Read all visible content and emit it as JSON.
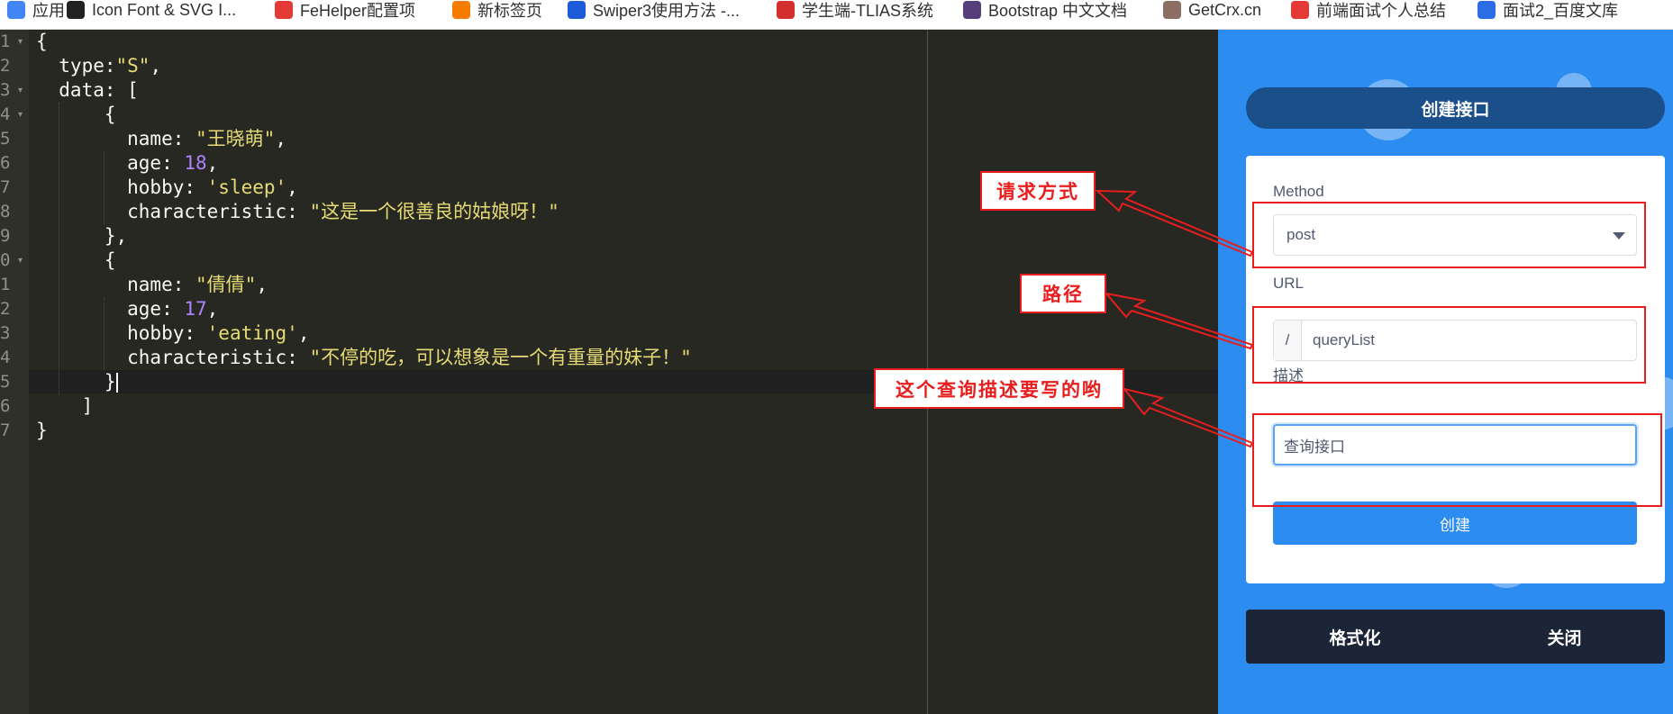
{
  "bookmarks": [
    {
      "label": "应用",
      "icon": "apps-grid-icon",
      "color": "#4285f4"
    },
    {
      "label": "Icon Font & SVG I...",
      "icon": "iconfont-icon",
      "color": "#222222"
    },
    {
      "label": "FeHelper配置项",
      "icon": "fehelper-icon",
      "color": "#e53935"
    },
    {
      "label": "新标签页",
      "icon": "new-tab-icon",
      "color": "#f57c00"
    },
    {
      "label": "Swiper3使用方法 -...",
      "icon": "swiper-icon",
      "color": "#1e5bd8"
    },
    {
      "label": "学生端-TLIAS系统",
      "icon": "tlias-icon",
      "color": "#d32f2f"
    },
    {
      "label": "Bootstrap 中文文档",
      "icon": "bootstrap-icon",
      "color": "#563d7c"
    },
    {
      "label": "GetCrx.cn",
      "icon": "getcrx-avatar-icon",
      "color": "#8d6e63"
    },
    {
      "label": "前端面试个人总结",
      "icon": "csdn-icon",
      "color": "#e53935"
    },
    {
      "label": "面试2_百度文库",
      "icon": "baidu-wenku-icon",
      "color": "#2b6de5"
    }
  ],
  "editor": {
    "lines": [
      {
        "num": "1",
        "fold": true,
        "html": "{"
      },
      {
        "num": "2",
        "fold": false,
        "html": "  type:<span class=\"s\">\"S\"</span>,"
      },
      {
        "num": "3",
        "fold": true,
        "html": "  data: ["
      },
      {
        "num": "4",
        "fold": true,
        "html": "      {"
      },
      {
        "num": "5",
        "fold": false,
        "html": "        name: <span class=\"s\">\"王晓萌\"</span>,"
      },
      {
        "num": "6",
        "fold": false,
        "html": "        age: <span class=\"n\">18</span>,"
      },
      {
        "num": "7",
        "fold": false,
        "html": "        hobby: <span class=\"s\">'sleep'</span>,"
      },
      {
        "num": "8",
        "fold": false,
        "html": "        characteristic: <span class=\"s\">\"这是一个很善良的姑娘呀！\"</span>"
      },
      {
        "num": "9",
        "fold": false,
        "html": "      },"
      },
      {
        "num": "0",
        "fold": true,
        "html": "      {"
      },
      {
        "num": "1",
        "fold": false,
        "html": "        name: <span class=\"s\">\"倩倩\"</span>,"
      },
      {
        "num": "2",
        "fold": false,
        "html": "        age: <span class=\"n\">17</span>,"
      },
      {
        "num": "3",
        "fold": false,
        "html": "        hobby: <span class=\"s\">'eating'</span>,"
      },
      {
        "num": "4",
        "fold": false,
        "html": "        characteristic: <span class=\"s\">\"不停的吃，可以想象是一个有重量的妹子！\"</span>"
      },
      {
        "num": "5",
        "fold": false,
        "html": "      }<span class=\"cursor\"></span>"
      },
      {
        "num": "6",
        "fold": false,
        "html": "    ]"
      },
      {
        "num": "7",
        "fold": false,
        "html": "}"
      }
    ]
  },
  "panel": {
    "title": "创建接口",
    "method_label": "Method",
    "method_value": "post",
    "url_label": "URL",
    "url_prefix": "/",
    "url_value": "queryList",
    "desc_label": "描述",
    "desc_value": "查询接口",
    "create_button": "创建",
    "format_button": "格式化",
    "close_button": "关闭"
  },
  "annotations": {
    "method_note": "请求方式",
    "url_note": "路径",
    "desc_note": "这个查询描述要写的哟",
    "color": "#e81e1e"
  }
}
